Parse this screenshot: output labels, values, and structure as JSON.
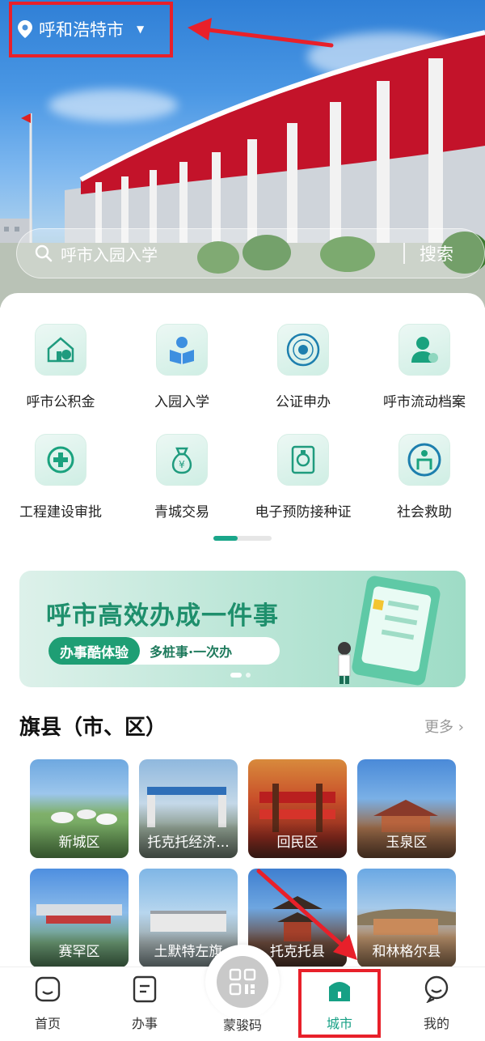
{
  "header": {
    "city": "呼和浩特市",
    "search_placeholder": "呼市入园入学",
    "search_button": "搜索"
  },
  "services": [
    {
      "label": "呼市公积金",
      "icon": "house-fund-icon"
    },
    {
      "label": "入园入学",
      "icon": "reading-student-icon"
    },
    {
      "label": "公证申办",
      "icon": "notary-seal-icon"
    },
    {
      "label": "呼市流动档案",
      "icon": "person-profile-icon"
    },
    {
      "label": "工程建设审批",
      "icon": "plus-circle-icon"
    },
    {
      "label": "青城交易",
      "icon": "money-bag-icon"
    },
    {
      "label": "电子预防接种证",
      "icon": "vaccine-certificate-icon"
    },
    {
      "label": "社会救助",
      "icon": "social-aid-icon"
    }
  ],
  "banner": {
    "title": "呼市高效办成一件事",
    "badge": "办事酷体验",
    "slogan": "多桩事·一次办"
  },
  "districts_section": {
    "title": "旗县（市、区）",
    "more": "更多",
    "items": [
      {
        "label": "新城区"
      },
      {
        "label": "托克托经济..."
      },
      {
        "label": "回民区"
      },
      {
        "label": "玉泉区"
      },
      {
        "label": "赛罕区"
      },
      {
        "label": "土默特左旗"
      },
      {
        "label": "托克托县"
      },
      {
        "label": "和林格尔县"
      }
    ]
  },
  "tabs": [
    {
      "label": "首页",
      "icon": "home-icon"
    },
    {
      "label": "办事",
      "icon": "document-icon"
    },
    {
      "label": "蒙骏码",
      "icon": "qr-code-icon"
    },
    {
      "label": "城市",
      "icon": "city-building-icon",
      "active": true
    },
    {
      "label": "我的",
      "icon": "profile-icon"
    }
  ],
  "colors": {
    "accent": "#16a085",
    "annotation": "#e8202a"
  }
}
